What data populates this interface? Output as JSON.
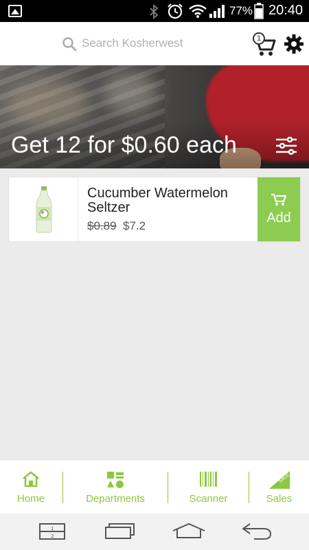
{
  "status_bar": {
    "battery_percent": "77%",
    "time": "20:40",
    "icons": [
      "gallery-icon",
      "bluetooth-icon",
      "alarm-icon",
      "wifi-icon",
      "signal-icon",
      "battery-icon"
    ]
  },
  "header": {
    "search_placeholder": "Search Kosherwest",
    "cart_count": "1"
  },
  "banner": {
    "title": "Get 12 for $0.60 each"
  },
  "product": {
    "name": "Cucumber Watermelon Seltzer",
    "old_price": "$0.89",
    "new_price": "$7.2",
    "add_label": "Add"
  },
  "tabs": [
    {
      "label": "Home",
      "icon": "home-icon"
    },
    {
      "label": "Departments",
      "icon": "departments-icon"
    },
    {
      "label": "Scanner",
      "icon": "barcode-icon"
    },
    {
      "label": "Sales",
      "icon": "sale-tag-icon"
    }
  ],
  "colors": {
    "accent": "#8cc83f",
    "add_button": "#8ccc50",
    "status_bar": "#000000"
  }
}
